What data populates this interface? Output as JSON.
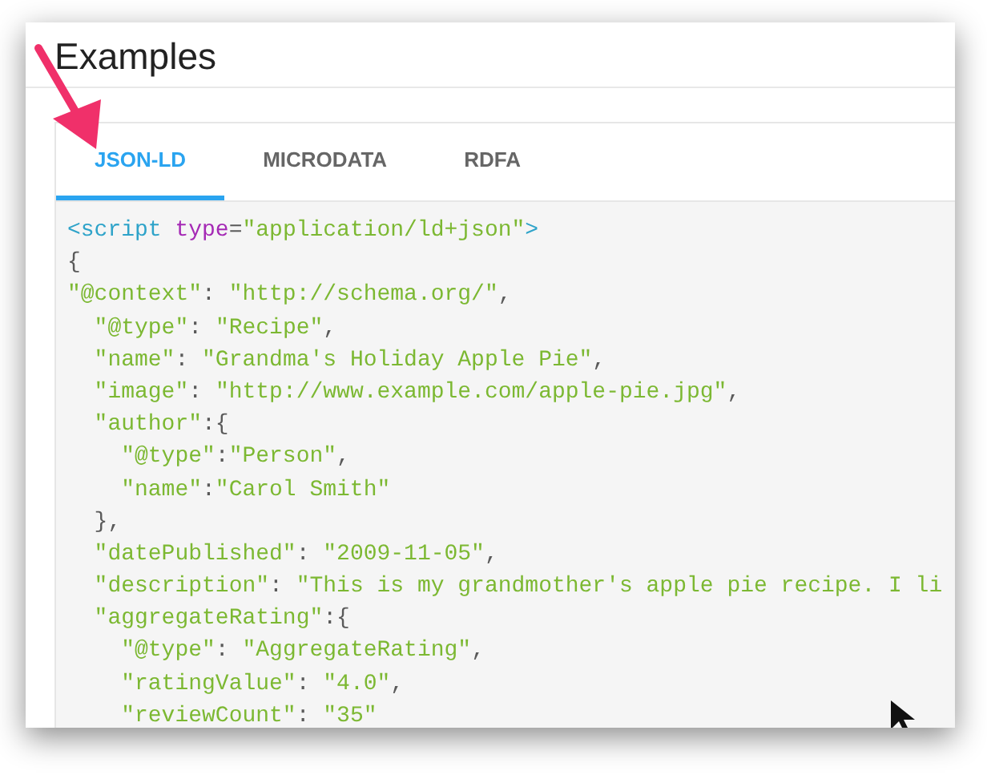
{
  "title": "Examples",
  "tabs": [
    {
      "label": "JSON-LD",
      "selected": true
    },
    {
      "label": "MICRODATA",
      "selected": false
    },
    {
      "label": "RDFA",
      "selected": false
    }
  ],
  "code": {
    "lines": [
      [
        {
          "kind": "tag",
          "text": "<script "
        },
        {
          "kind": "attr",
          "text": "type"
        },
        {
          "kind": "punct",
          "text": "="
        },
        {
          "kind": "str",
          "text": "\"application/ld+json\""
        },
        {
          "kind": "tag",
          "text": ">"
        }
      ],
      [
        {
          "kind": "punct",
          "text": "{"
        }
      ],
      [
        {
          "kind": "str",
          "text": "\"@context\""
        },
        {
          "kind": "punct",
          "text": ": "
        },
        {
          "kind": "str",
          "text": "\"http://schema.org/\""
        },
        {
          "kind": "punct",
          "text": ","
        }
      ],
      [
        {
          "kind": "str",
          "text": "  \"@type\""
        },
        {
          "kind": "punct",
          "text": ": "
        },
        {
          "kind": "str",
          "text": "\"Recipe\""
        },
        {
          "kind": "punct",
          "text": ","
        }
      ],
      [
        {
          "kind": "str",
          "text": "  \"name\""
        },
        {
          "kind": "punct",
          "text": ": "
        },
        {
          "kind": "str",
          "text": "\"Grandma's Holiday Apple Pie\""
        },
        {
          "kind": "punct",
          "text": ","
        }
      ],
      [
        {
          "kind": "str",
          "text": "  \"image\""
        },
        {
          "kind": "punct",
          "text": ": "
        },
        {
          "kind": "str",
          "text": "\"http://www.example.com/apple-pie.jpg\""
        },
        {
          "kind": "punct",
          "text": ","
        }
      ],
      [
        {
          "kind": "str",
          "text": "  \"author\""
        },
        {
          "kind": "punct",
          "text": ":{"
        }
      ],
      [
        {
          "kind": "str",
          "text": "    \"@type\""
        },
        {
          "kind": "punct",
          "text": ":"
        },
        {
          "kind": "str",
          "text": "\"Person\""
        },
        {
          "kind": "punct",
          "text": ","
        }
      ],
      [
        {
          "kind": "str",
          "text": "    \"name\""
        },
        {
          "kind": "punct",
          "text": ":"
        },
        {
          "kind": "str",
          "text": "\"Carol Smith\""
        }
      ],
      [
        {
          "kind": "punct",
          "text": "  },"
        }
      ],
      [
        {
          "kind": "str",
          "text": "  \"datePublished\""
        },
        {
          "kind": "punct",
          "text": ": "
        },
        {
          "kind": "str",
          "text": "\"2009-11-05\""
        },
        {
          "kind": "punct",
          "text": ","
        }
      ],
      [
        {
          "kind": "str",
          "text": "  \"description\""
        },
        {
          "kind": "punct",
          "text": ": "
        },
        {
          "kind": "str",
          "text": "\"This is my grandmother's apple pie recipe. I li"
        }
      ],
      [
        {
          "kind": "str",
          "text": "  \"aggregateRating\""
        },
        {
          "kind": "punct",
          "text": ":{"
        }
      ],
      [
        {
          "kind": "str",
          "text": "    \"@type\""
        },
        {
          "kind": "punct",
          "text": ": "
        },
        {
          "kind": "str",
          "text": "\"AggregateRating\""
        },
        {
          "kind": "punct",
          "text": ","
        }
      ],
      [
        {
          "kind": "str",
          "text": "    \"ratingValue\""
        },
        {
          "kind": "punct",
          "text": ": "
        },
        {
          "kind": "str",
          "text": "\"4.0\""
        },
        {
          "kind": "punct",
          "text": ","
        }
      ],
      [
        {
          "kind": "str",
          "text": "    \"reviewCount\""
        },
        {
          "kind": "punct",
          "text": ": "
        },
        {
          "kind": "str",
          "text": "\"35\""
        }
      ]
    ]
  }
}
